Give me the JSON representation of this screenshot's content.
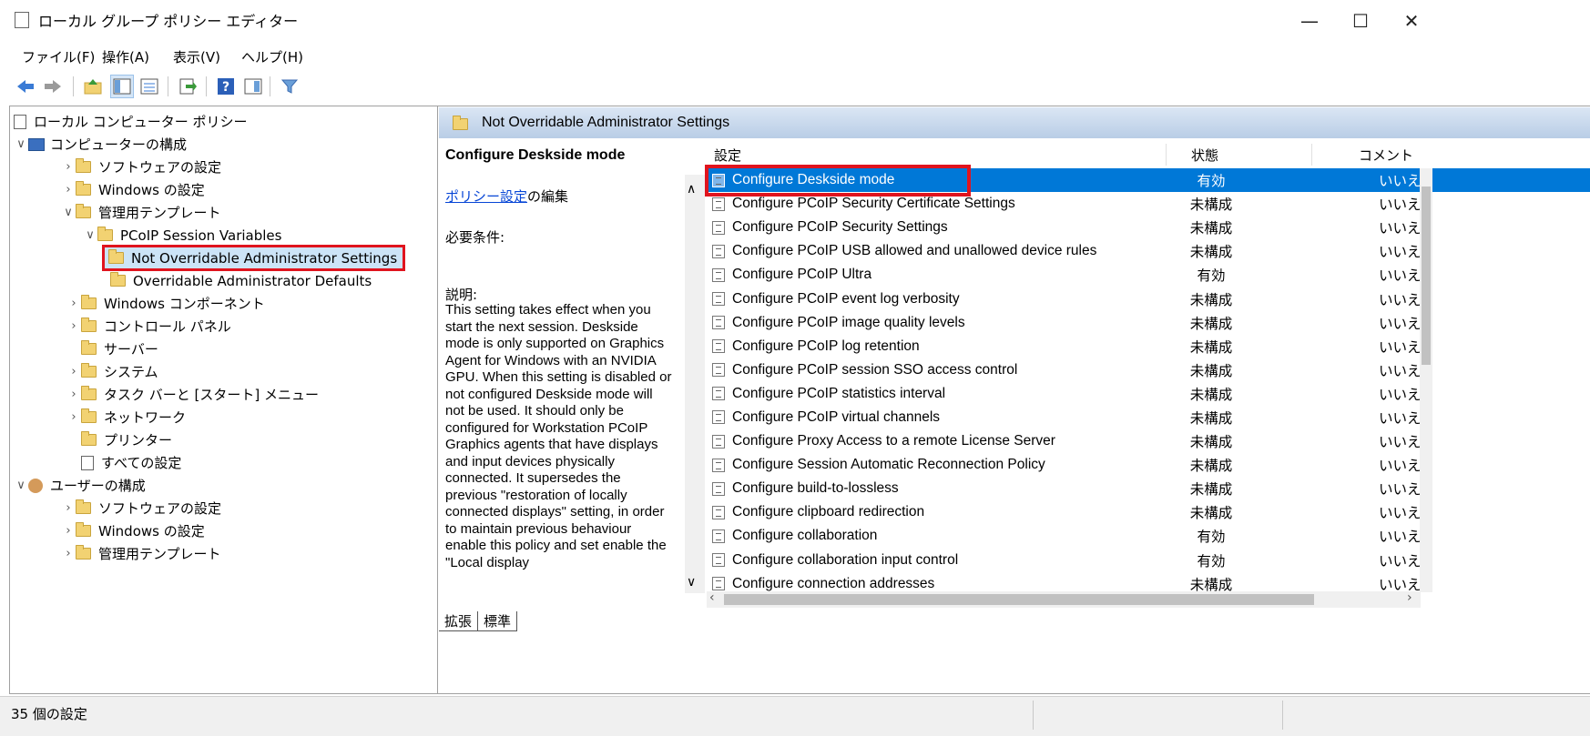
{
  "window": {
    "title": "ローカル グループ ポリシー エディター",
    "min": "—",
    "max": "☐",
    "close": "✕"
  },
  "menu": [
    "ファイル(F)",
    "操作(A)",
    "表示(V)",
    "ヘルプ(H)"
  ],
  "toolbar": {
    "icons": [
      "back-arrow-icon",
      "forward-arrow-icon",
      "up-folder-icon",
      "show-hide-tree-icon",
      "export-list-icon",
      "help-icon",
      "properties-icon",
      "filter-icon"
    ]
  },
  "tree": {
    "root": "ローカル コンピューター ポリシー",
    "computer_config": "コンピューターの構成",
    "software_settings": "ソフトウェアの設定",
    "windows_settings": "Windows の設定",
    "admin_templates": "管理用テンプレート",
    "pcoip_vars": "PCoIP Session Variables",
    "not_overridable": "Not Overridable Administrator Settings",
    "overridable": "Overridable Administrator Defaults",
    "windows_components": "Windows コンポーネント",
    "control_panel": "コントロール パネル",
    "server": "サーバー",
    "system": "システム",
    "taskbar": "タスク バーと [スタート] メニュー",
    "network": "ネットワーク",
    "printers": "プリンター",
    "all_settings": "すべての設定",
    "user_config": "ユーザーの構成",
    "user_software": "ソフトウェアの設定",
    "user_windows": "Windows の設定",
    "user_admin": "管理用テンプレート"
  },
  "right": {
    "header": "Not Overridable Administrator Settings",
    "desc_title": "Configure Deskside mode",
    "policy_link": "ポリシー設定",
    "edit_suffix": "の編集",
    "requirements": "必要条件:",
    "desc_label": "説明:",
    "desc_body": "This setting takes effect when you start the next session. Deskside mode is only supported on Graphics Agent for Windows with an NVIDIA GPU. When this setting is disabled or not configured Deskside mode will not be used. It should only be configured for Workstation PCoIP Graphics agents that have displays and input devices physically connected. It supersedes the previous \"restoration of locally connected displays\" setting, in order to maintain previous behaviour enable this policy and set enable the \"Local display",
    "col_setting": "設定",
    "col_state": "状態",
    "col_comment": "コメント"
  },
  "settings": [
    {
      "name": "Configure Deskside mode",
      "state": "有効",
      "comment": "いいえ"
    },
    {
      "name": "Configure PCoIP Security Certificate Settings",
      "state": "未構成",
      "comment": "いいえ"
    },
    {
      "name": "Configure PCoIP Security Settings",
      "state": "未構成",
      "comment": "いいえ"
    },
    {
      "name": "Configure PCoIP USB allowed and unallowed device rules",
      "state": "未構成",
      "comment": "いいえ"
    },
    {
      "name": "Configure PCoIP Ultra",
      "state": "有効",
      "comment": "いいえ"
    },
    {
      "name": "Configure PCoIP event log verbosity",
      "state": "未構成",
      "comment": "いいえ"
    },
    {
      "name": "Configure PCoIP image quality levels",
      "state": "未構成",
      "comment": "いいえ"
    },
    {
      "name": "Configure PCoIP log retention",
      "state": "未構成",
      "comment": "いいえ"
    },
    {
      "name": "Configure PCoIP session SSO access control",
      "state": "未構成",
      "comment": "いいえ"
    },
    {
      "name": "Configure PCoIP statistics interval",
      "state": "未構成",
      "comment": "いいえ"
    },
    {
      "name": "Configure PCoIP virtual channels",
      "state": "未構成",
      "comment": "いいえ"
    },
    {
      "name": "Configure Proxy Access to a remote License Server",
      "state": "未構成",
      "comment": "いいえ"
    },
    {
      "name": "Configure Session Automatic Reconnection Policy",
      "state": "未構成",
      "comment": "いいえ"
    },
    {
      "name": "Configure build-to-lossless",
      "state": "未構成",
      "comment": "いいえ"
    },
    {
      "name": "Configure clipboard redirection",
      "state": "未構成",
      "comment": "いいえ"
    },
    {
      "name": "Configure collaboration",
      "state": "有効",
      "comment": "いいえ"
    },
    {
      "name": "Configure collaboration input control",
      "state": "有効",
      "comment": "いいえ"
    },
    {
      "name": "Configure connection addresses",
      "state": "未構成",
      "comment": "いいえ"
    }
  ],
  "tabs": [
    "拡張",
    "標準"
  ],
  "status": "35 個の設定",
  "colors": {
    "selection": "#0078d7",
    "highlight_box": "#e0141e",
    "header_grad_top": "#dbe6f4",
    "header_grad_bottom": "#b9cde6",
    "link": "#0645d6"
  }
}
